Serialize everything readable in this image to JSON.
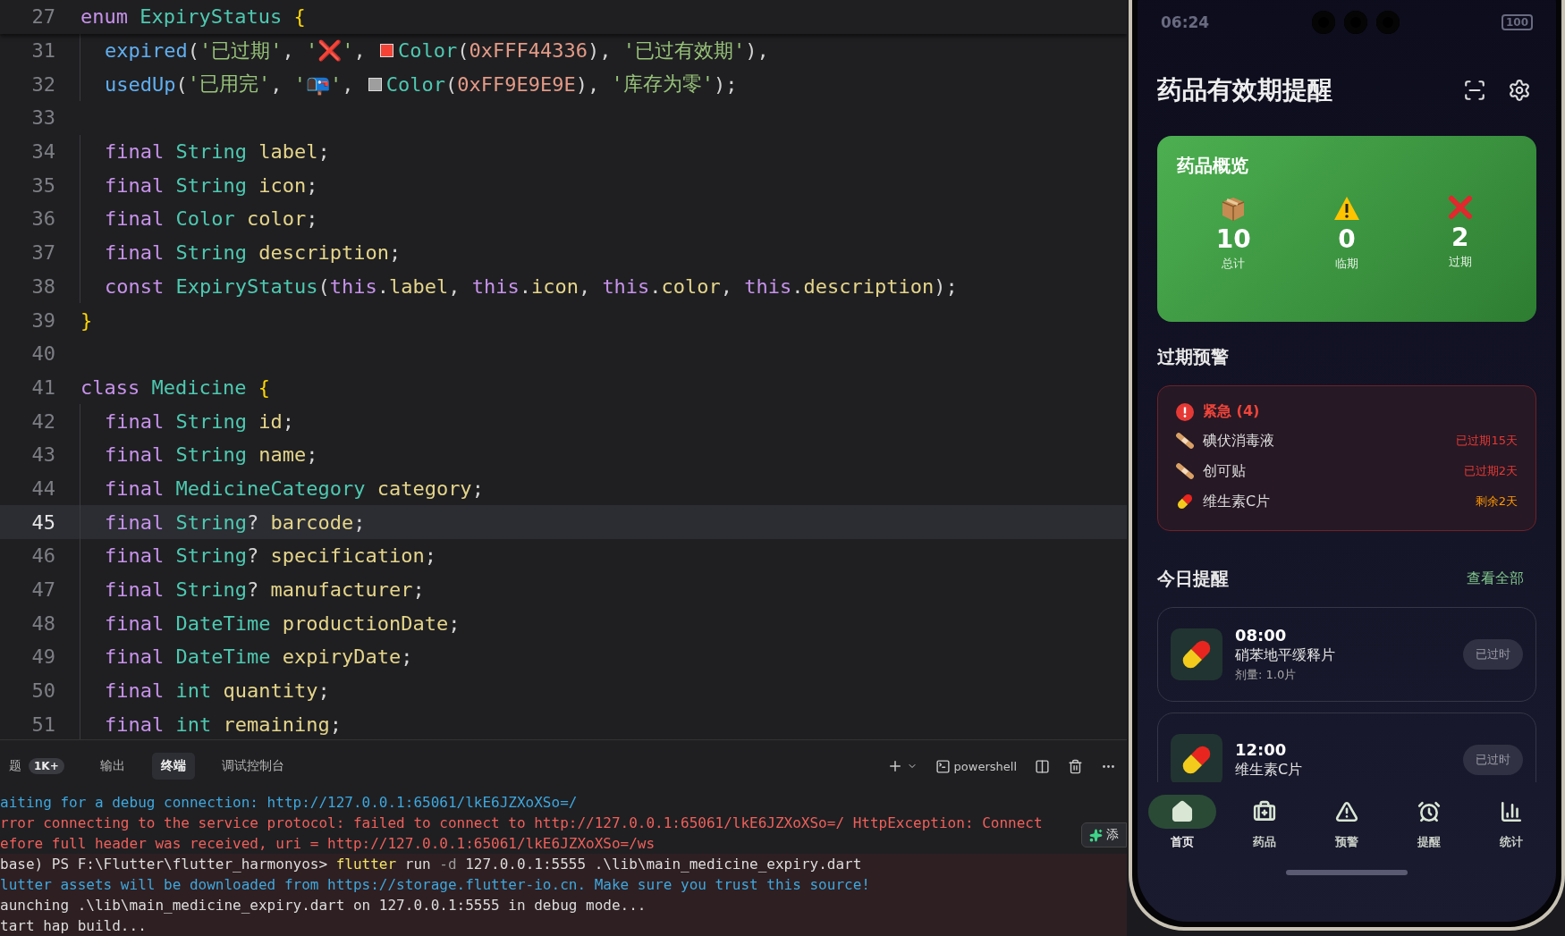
{
  "editor": {
    "sticky_line": {
      "number": "27",
      "indented": false,
      "selected": false,
      "tokens": [
        {
          "kind": "keyword",
          "text": "enum "
        },
        {
          "kind": "type",
          "text": "ExpiryStatus "
        },
        {
          "kind": "brace",
          "text": "{"
        }
      ]
    },
    "lines": [
      {
        "number": "31",
        "indented": true,
        "selected": false,
        "tokens": [
          {
            "kind": "func",
            "text": "expired"
          },
          {
            "kind": "punct",
            "text": "("
          },
          {
            "kind": "string",
            "text": "'已过期'"
          },
          {
            "kind": "punct",
            "text": ", "
          },
          {
            "kind": "string",
            "text": "'❌'"
          },
          {
            "kind": "punct",
            "text": ", "
          },
          {
            "kind": "swatch",
            "color": "#f44336"
          },
          {
            "kind": "type",
            "text": "Color"
          },
          {
            "kind": "punct",
            "text": "("
          },
          {
            "kind": "number",
            "text": "0xFFF44336"
          },
          {
            "kind": "punct",
            "text": "), "
          },
          {
            "kind": "string",
            "text": "'已过有效期'"
          },
          {
            "kind": "punct",
            "text": "),"
          }
        ]
      },
      {
        "number": "32",
        "indented": true,
        "selected": false,
        "tokens": [
          {
            "kind": "func",
            "text": "usedUp"
          },
          {
            "kind": "punct",
            "text": "("
          },
          {
            "kind": "string",
            "text": "'已用完'"
          },
          {
            "kind": "punct",
            "text": ", "
          },
          {
            "kind": "string",
            "text": "'📭'"
          },
          {
            "kind": "punct",
            "text": ", "
          },
          {
            "kind": "swatch",
            "color": "#9e9e9e"
          },
          {
            "kind": "type",
            "text": "Color"
          },
          {
            "kind": "punct",
            "text": "("
          },
          {
            "kind": "number",
            "text": "0xFF9E9E9E"
          },
          {
            "kind": "punct",
            "text": "), "
          },
          {
            "kind": "string",
            "text": "'库存为零'"
          },
          {
            "kind": "punct",
            "text": ");"
          }
        ]
      },
      {
        "number": "33",
        "indented": false,
        "selected": false
      },
      {
        "number": "34",
        "indented": true,
        "selected": false,
        "tokens": [
          {
            "kind": "keyword",
            "text": "final "
          },
          {
            "kind": "type",
            "text": "String "
          },
          {
            "kind": "field",
            "text": "label"
          },
          {
            "kind": "punct",
            "text": ";"
          }
        ]
      },
      {
        "number": "35",
        "indented": true,
        "selected": false,
        "tokens": [
          {
            "kind": "keyword",
            "text": "final "
          },
          {
            "kind": "type",
            "text": "String "
          },
          {
            "kind": "field",
            "text": "icon"
          },
          {
            "kind": "punct",
            "text": ";"
          }
        ]
      },
      {
        "number": "36",
        "indented": true,
        "selected": false,
        "tokens": [
          {
            "kind": "keyword",
            "text": "final "
          },
          {
            "kind": "type",
            "text": "Color "
          },
          {
            "kind": "field",
            "text": "color"
          },
          {
            "kind": "punct",
            "text": ";"
          }
        ]
      },
      {
        "number": "37",
        "indented": true,
        "selected": false,
        "tokens": [
          {
            "kind": "keyword",
            "text": "final "
          },
          {
            "kind": "type",
            "text": "String "
          },
          {
            "kind": "field",
            "text": "description"
          },
          {
            "kind": "punct",
            "text": ";"
          }
        ]
      },
      {
        "number": "38",
        "indented": true,
        "selected": false,
        "tokens": [
          {
            "kind": "keyword",
            "text": "const "
          },
          {
            "kind": "type",
            "text": "ExpiryStatus"
          },
          {
            "kind": "punct",
            "text": "("
          },
          {
            "kind": "keyword",
            "text": "this"
          },
          {
            "kind": "punct",
            "text": "."
          },
          {
            "kind": "field",
            "text": "label"
          },
          {
            "kind": "punct",
            "text": ", "
          },
          {
            "kind": "keyword",
            "text": "this"
          },
          {
            "kind": "punct",
            "text": "."
          },
          {
            "kind": "field",
            "text": "icon"
          },
          {
            "kind": "punct",
            "text": ", "
          },
          {
            "kind": "keyword",
            "text": "this"
          },
          {
            "kind": "punct",
            "text": "."
          },
          {
            "kind": "field",
            "text": "color"
          },
          {
            "kind": "punct",
            "text": ", "
          },
          {
            "kind": "keyword",
            "text": "this"
          },
          {
            "kind": "punct",
            "text": "."
          },
          {
            "kind": "field",
            "text": "description"
          },
          {
            "kind": "punct",
            "text": ");"
          }
        ]
      },
      {
        "number": "39",
        "indented": false,
        "selected": false,
        "tokens": [
          {
            "kind": "brace",
            "text": "}"
          }
        ]
      },
      {
        "number": "40",
        "indented": false,
        "selected": false
      },
      {
        "number": "41",
        "indented": false,
        "selected": false,
        "tokens": [
          {
            "kind": "keyword",
            "text": "class "
          },
          {
            "kind": "type",
            "text": "Medicine "
          },
          {
            "kind": "brace",
            "text": "{"
          }
        ]
      },
      {
        "number": "42",
        "indented": true,
        "selected": false,
        "tokens": [
          {
            "kind": "keyword",
            "text": "final "
          },
          {
            "kind": "type",
            "text": "String "
          },
          {
            "kind": "field",
            "text": "id"
          },
          {
            "kind": "punct",
            "text": ";"
          }
        ]
      },
      {
        "number": "43",
        "indented": true,
        "selected": false,
        "tokens": [
          {
            "kind": "keyword",
            "text": "final "
          },
          {
            "kind": "type",
            "text": "String "
          },
          {
            "kind": "field",
            "text": "name"
          },
          {
            "kind": "punct",
            "text": ";"
          }
        ]
      },
      {
        "number": "44",
        "indented": true,
        "selected": false,
        "tokens": [
          {
            "kind": "keyword",
            "text": "final "
          },
          {
            "kind": "type",
            "text": "MedicineCategory "
          },
          {
            "kind": "field",
            "text": "category"
          },
          {
            "kind": "punct",
            "text": ";"
          }
        ]
      },
      {
        "number": "45",
        "indented": true,
        "selected": true,
        "tokens": [
          {
            "kind": "keyword",
            "text": "final "
          },
          {
            "kind": "type",
            "text": "String"
          },
          {
            "kind": "punct",
            "text": "? "
          },
          {
            "kind": "field",
            "text": "barcode"
          },
          {
            "kind": "punct",
            "text": ";"
          }
        ]
      },
      {
        "number": "46",
        "indented": true,
        "selected": false,
        "tokens": [
          {
            "kind": "keyword",
            "text": "final "
          },
          {
            "kind": "type",
            "text": "String"
          },
          {
            "kind": "punct",
            "text": "? "
          },
          {
            "kind": "field",
            "text": "specification"
          },
          {
            "kind": "punct",
            "text": ";"
          }
        ]
      },
      {
        "number": "47",
        "indented": true,
        "selected": false,
        "tokens": [
          {
            "kind": "keyword",
            "text": "final "
          },
          {
            "kind": "type",
            "text": "String"
          },
          {
            "kind": "punct",
            "text": "? "
          },
          {
            "kind": "field",
            "text": "manufacturer"
          },
          {
            "kind": "punct",
            "text": ";"
          }
        ]
      },
      {
        "number": "48",
        "indented": true,
        "selected": false,
        "tokens": [
          {
            "kind": "keyword",
            "text": "final "
          },
          {
            "kind": "type",
            "text": "DateTime "
          },
          {
            "kind": "field",
            "text": "productionDate"
          },
          {
            "kind": "punct",
            "text": ";"
          }
        ]
      },
      {
        "number": "49",
        "indented": true,
        "selected": false,
        "tokens": [
          {
            "kind": "keyword",
            "text": "final "
          },
          {
            "kind": "type",
            "text": "DateTime "
          },
          {
            "kind": "field",
            "text": "expiryDate"
          },
          {
            "kind": "punct",
            "text": ";"
          }
        ]
      },
      {
        "number": "50",
        "indented": true,
        "selected": false,
        "tokens": [
          {
            "kind": "keyword",
            "text": "final "
          },
          {
            "kind": "type",
            "text": "int "
          },
          {
            "kind": "field",
            "text": "quantity"
          },
          {
            "kind": "punct",
            "text": ";"
          }
        ]
      },
      {
        "number": "51",
        "indented": true,
        "selected": false,
        "tokens": [
          {
            "kind": "keyword",
            "text": "final "
          },
          {
            "kind": "type",
            "text": "int "
          },
          {
            "kind": "field",
            "text": "remaining"
          },
          {
            "kind": "punct",
            "text": ";"
          }
        ]
      }
    ]
  },
  "panel": {
    "tabs": [
      {
        "label": "题",
        "badge": "1K+",
        "selected": false
      },
      {
        "label": "输出",
        "selected": false
      },
      {
        "label": "终端",
        "selected": true
      },
      {
        "label": "调试控制台",
        "selected": false
      }
    ],
    "shell": "powershell",
    "terminal_lines": [
      {
        "highlighted": false,
        "segments": [
          {
            "kind": "info",
            "text": "aiting for a debug connection: http://127.0.0.1:65061/lkE6JZXoXSo=/"
          }
        ]
      },
      {
        "highlighted": false,
        "segments": [
          {
            "kind": "error",
            "text": "rror connecting to the service protocol: failed to connect to http://127.0.0.1:65061/lkE6JZXoXSo=/ HttpException: Connect"
          }
        ]
      },
      {
        "highlighted": false,
        "segments": [
          {
            "kind": "error",
            "text": "efore full header was received, uri = http://127.0.0.1:65061/lkE6JZXoXSo=/ws"
          }
        ]
      },
      {
        "highlighted": true,
        "segments": [
          {
            "kind": "plain",
            "text": "base) PS F:\\Flutter\\flutter_harmonyos> "
          },
          {
            "kind": "command",
            "text": "flutter"
          },
          {
            "kind": "plain",
            "text": " run "
          },
          {
            "kind": "flag",
            "text": "-d"
          },
          {
            "kind": "plain",
            "text": " 127.0.0.1:5555 .\\lib\\main_medicine_expiry.dart"
          }
        ]
      },
      {
        "highlighted": true,
        "segments": [
          {
            "kind": "info",
            "text": "lutter assets will be downloaded from https://storage.flutter-io.cn. Make sure you trust this source!"
          }
        ]
      },
      {
        "highlighted": true,
        "segments": [
          {
            "kind": "plain",
            "text": "aunching .\\lib\\main_medicine_expiry.dart on 127.0.0.1:5555 in debug mode..."
          }
        ]
      },
      {
        "highlighted": true,
        "segments": [
          {
            "kind": "plain",
            "text": "tart hap build..."
          }
        ]
      }
    ],
    "assistant_button": {
      "label": "添"
    }
  },
  "phone": {
    "status_bar": {
      "time": "06:24",
      "battery": "100"
    },
    "title": "药品有效期提醒",
    "overview": {
      "title": "药品概览",
      "stats": [
        {
          "kind": "box",
          "value": "10",
          "label": "总计"
        },
        {
          "kind": "warning",
          "value": "0",
          "label": "临期"
        },
        {
          "kind": "cross",
          "value": "2",
          "label": "过期"
        }
      ]
    },
    "alerts_title": "过期预警",
    "alerts": {
      "heading": "紧急 (4)",
      "items": [
        {
          "kind": "bandage",
          "name": "碘伏消毒液",
          "status": "已过期15天",
          "color": "#e53935"
        },
        {
          "kind": "bandage",
          "name": "创可贴",
          "status": "已过期2天",
          "color": "#e53935"
        },
        {
          "kind": "pill",
          "name": "维生素C片",
          "status": "剩余2天",
          "color": "#ff9800"
        }
      ]
    },
    "reminders_title": "今日提醒",
    "view_all": "查看全部",
    "reminders": [
      {
        "time": "08:00",
        "name": "硝苯地平缓释片",
        "dose": "剂量: 1.0片",
        "status": "已过时"
      },
      {
        "time": "12:00",
        "name": "维生素C片",
        "status": "已过时"
      }
    ],
    "nav": [
      {
        "kind": "home",
        "label": "首页",
        "selected": true
      },
      {
        "kind": "bottle",
        "label": "药品",
        "selected": false
      },
      {
        "kind": "warning",
        "label": "预警",
        "selected": false
      },
      {
        "kind": "alarm",
        "label": "提醒",
        "selected": false
      },
      {
        "kind": "chart",
        "label": "统计",
        "selected": false
      }
    ]
  }
}
